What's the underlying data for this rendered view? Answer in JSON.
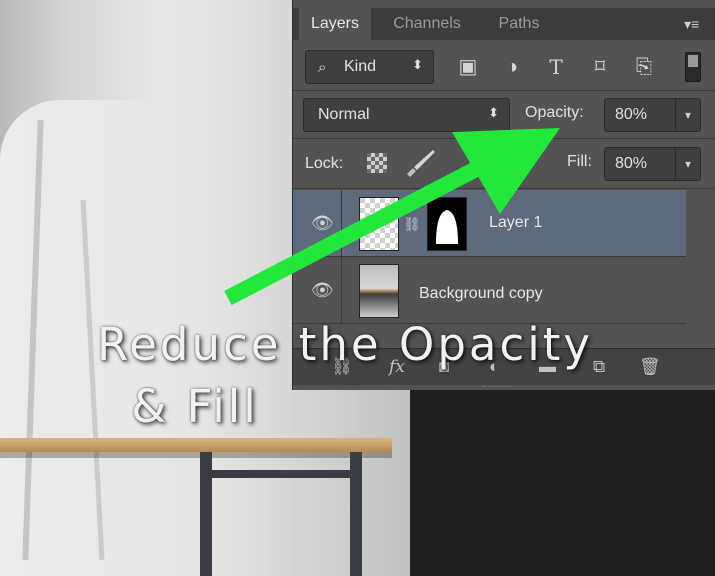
{
  "panel": {
    "tabs": [
      "Layers",
      "Channels",
      "Paths"
    ],
    "active_tab": "Layers",
    "menu_icon": "panel-menu-icon",
    "filter": {
      "label": "Kind",
      "icon": "search-icon",
      "arrow": "⬍"
    },
    "filter_icons": [
      "image-filter-icon",
      "adjustment-filter-icon",
      "type-filter-icon",
      "shape-filter-icon",
      "smart-object-filter-icon"
    ],
    "blend_mode": "Normal",
    "opacity_label": "Opacity:",
    "opacity_value": "80%",
    "lock_label": "Lock:",
    "fill_label": "Fill:",
    "fill_value": "80%",
    "dropdown_arrow": "▾"
  },
  "layers": [
    {
      "name": "Layer 1",
      "visible": true,
      "selected": true,
      "has_mask": true
    },
    {
      "name": "Background copy",
      "visible": true,
      "selected": false,
      "has_mask": false
    }
  ],
  "bottom_bar": {
    "fx": "fx",
    "trash": "🗑"
  },
  "caption": {
    "line1": "Reduce the Opacity",
    "line2": "& Fill"
  },
  "arrow_color": "#22e83a"
}
